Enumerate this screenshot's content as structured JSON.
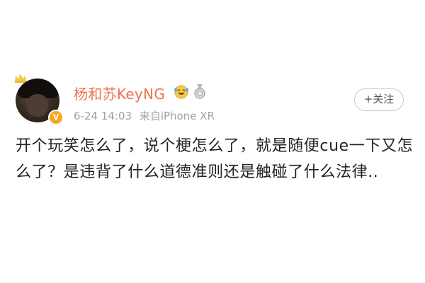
{
  "user": {
    "name": "杨和苏KeyNG",
    "verified_badge": "V",
    "avatar": "avatar-photo",
    "crown_icon": "crown-icon"
  },
  "post": {
    "date": "6-24 14:03",
    "source": "来自iPhone XR",
    "text": "开个玩笑怎么了，说个梗怎么了，就是随便cue一下又怎么了？是违背了什么道德准则还是触碰了什么法律.."
  },
  "actions": {
    "follow_label": "+关注"
  },
  "colors": {
    "username": "#eb7350",
    "meta": "#a0a0a0",
    "text": "#222222",
    "badge": "#f5a623"
  }
}
